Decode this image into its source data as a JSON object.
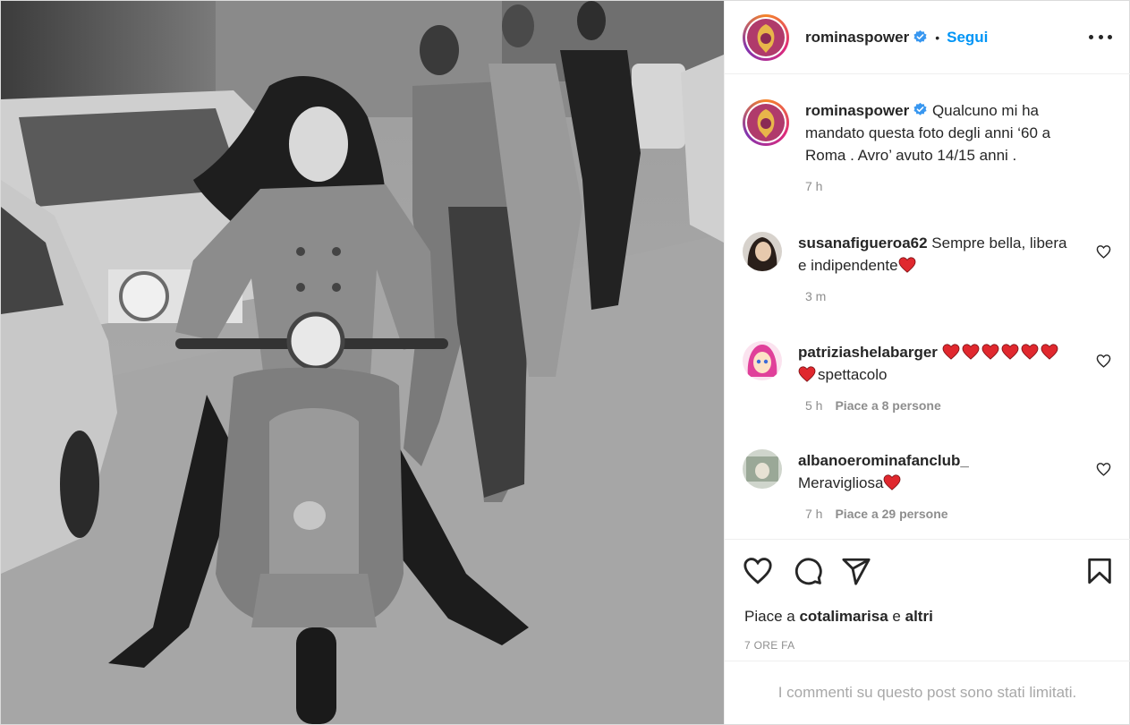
{
  "post": {
    "author": "rominaspower",
    "follow_label": "Segui",
    "separator": "•",
    "caption": "Qualcuno mi ha mandato questa foto degli anni ‘60 a Roma . Avro’ avuto 14/15 anni .",
    "caption_time": "7 h"
  },
  "comments": [
    {
      "user": "susanafigueroa62",
      "text": "Sempre bella, libera e indipendente",
      "time": "3 m",
      "likes": ""
    },
    {
      "user": "patriziashelabarger",
      "text": "spettacolo",
      "time": "5 h",
      "likes": "Piace a 8 persone"
    },
    {
      "user": "albanoerominafanclub_",
      "text": "Meravigliosa",
      "time": "7 h",
      "likes": "Piace a 29 persone"
    }
  ],
  "footer": {
    "likes_prefix": "Piace a",
    "likes_user": "cotalimarisa",
    "likes_conj": "e",
    "likes_others": "altri",
    "timestamp": "7 ORE FA",
    "comments_limited": "I commenti su questo post sono stati limitati."
  },
  "icons": {
    "like": "heart-icon",
    "comment": "comment-icon",
    "share": "paper-plane-icon",
    "save": "bookmark-icon",
    "verified": "verified-badge-icon",
    "more": "more-options-icon"
  },
  "colors": {
    "follow": "#0095f6",
    "verified": "#3897f0",
    "heart_emoji": "#e0282e",
    "muted_text": "#8e8e8e"
  }
}
